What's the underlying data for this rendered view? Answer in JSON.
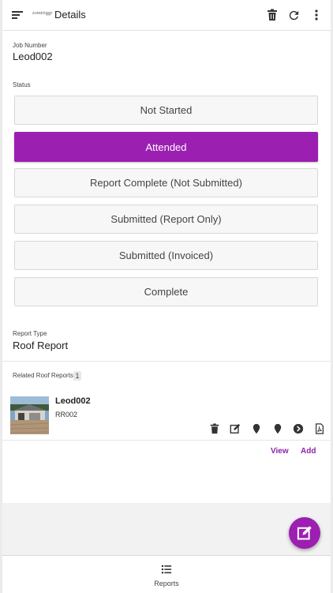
{
  "header": {
    "logo_text": "zomtriggr",
    "title": "Details",
    "icons": [
      "menu-icon",
      "trash-icon",
      "refresh-icon",
      "more-vert-icon"
    ]
  },
  "job": {
    "label": "Job Number",
    "value": "Leod002"
  },
  "status": {
    "label": "Status",
    "options": [
      "Not Started",
      "Attended",
      "Report Complete (Not Submitted)",
      "Submitted (Report Only)",
      "Submitted (Invoiced)",
      "Complete"
    ],
    "selected": "Attended"
  },
  "report_type": {
    "label": "Report Type",
    "value": "Roof Report"
  },
  "related": {
    "label": "Related Roof Reports",
    "count": "1",
    "items": [
      {
        "title": "Leod002",
        "code": "RR002",
        "actions": [
          "trash-icon",
          "edit-icon",
          "location-pin-icon",
          "location-pin-icon",
          "arrow-right-circle-icon",
          "pdf-icon"
        ]
      }
    ],
    "view_label": "View",
    "add_label": "Add"
  },
  "bottom_nav": {
    "reports_label": "Reports"
  },
  "colors": {
    "accent": "#9b1fb0",
    "link": "#8e24aa"
  }
}
